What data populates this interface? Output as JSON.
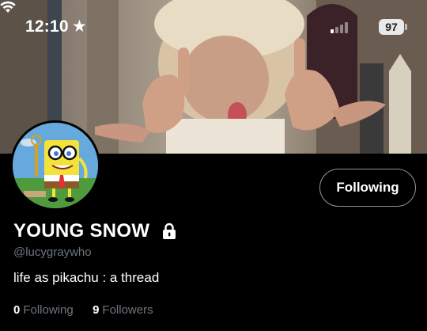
{
  "status_bar": {
    "time": "12:10",
    "focus_icon": "star-icon",
    "battery": "97"
  },
  "profile": {
    "display_name": "YOUNG SNOW",
    "handle": "@lucygraywho",
    "bio": "life as pikachu : a thread",
    "following_count": "0",
    "following_label": "Following",
    "followers_count": "9",
    "followers_label": "Followers",
    "follow_button_label": "Following",
    "locked_icon": "lock-icon"
  },
  "colors": {
    "background": "#000000",
    "secondary_text": "#6e767d",
    "button_border": "#8b97a6"
  }
}
